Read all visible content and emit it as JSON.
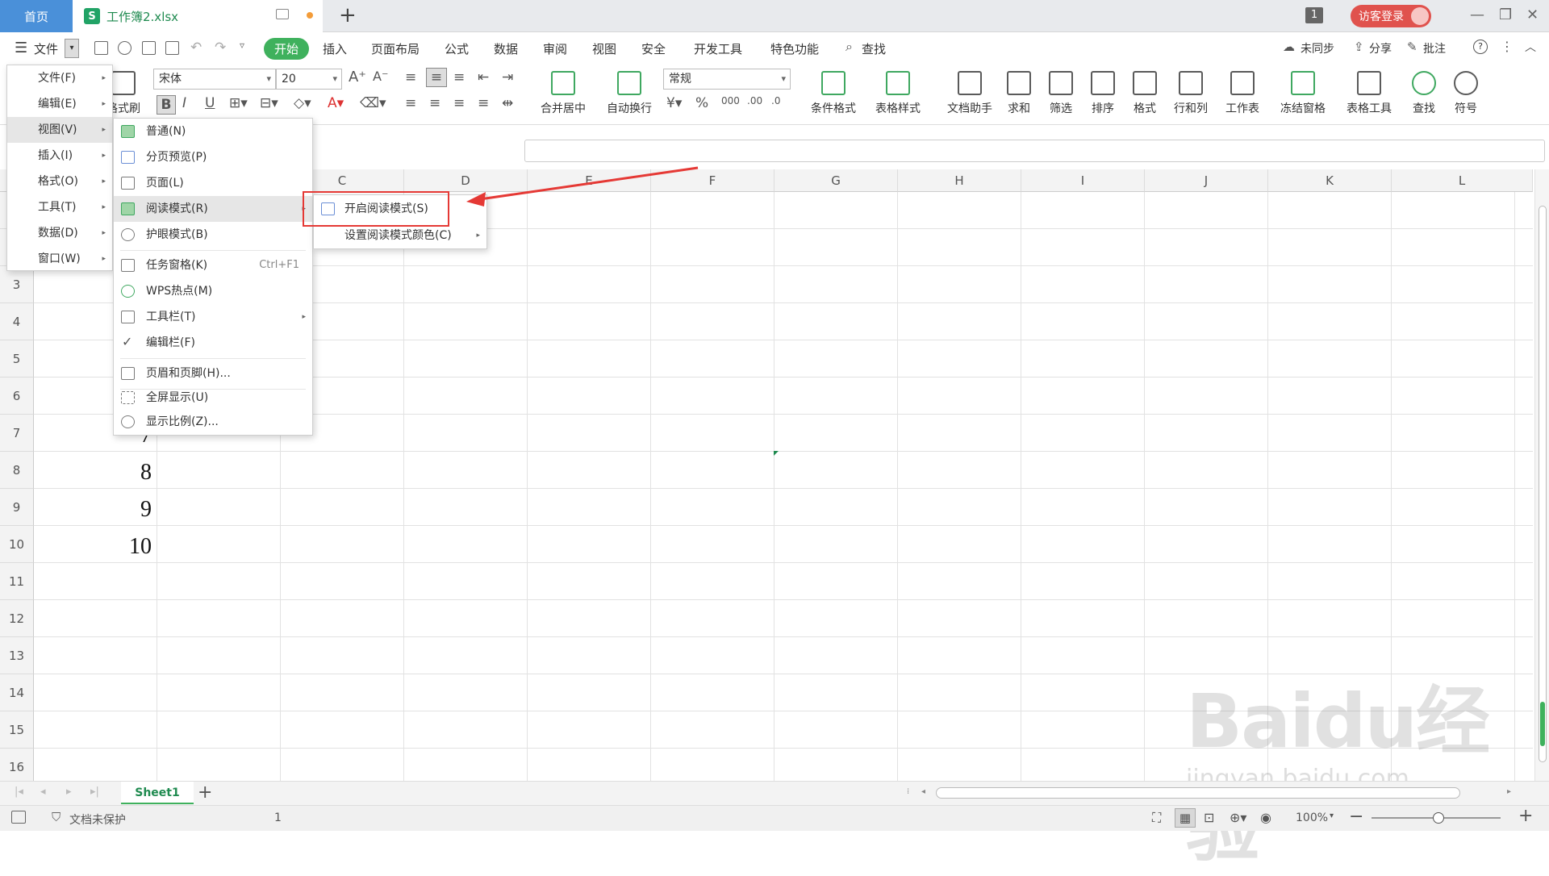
{
  "titlebar": {
    "home_tab": "首页",
    "file_tab": "工作簿2.xlsx",
    "file_icon_letter": "S",
    "window_count": "1",
    "visitor_login": "访客登录"
  },
  "menubar": {
    "file_menu": "文件",
    "tabs": [
      "开始",
      "插入",
      "页面布局",
      "公式",
      "数据",
      "审阅",
      "视图",
      "安全",
      "开发工具",
      "特色功能"
    ],
    "search": "查找",
    "right": [
      "未同步",
      "分享",
      "批注"
    ]
  },
  "ribbon": {
    "format_brush": "格式刷",
    "font_name": "宋体",
    "font_size": "20",
    "number_format": "常规",
    "merge_center": "合并居中",
    "auto_wrap": "自动换行",
    "buttons": [
      "条件格式",
      "表格样式",
      "文档助手",
      "求和",
      "筛选",
      "排序",
      "格式",
      "行和列",
      "工作表",
      "冻结窗格",
      "表格工具",
      "查找",
      "符号"
    ]
  },
  "grid": {
    "columns": [
      "C",
      "D",
      "E",
      "F",
      "G",
      "H",
      "I",
      "J",
      "K",
      "L"
    ],
    "rows": [
      "3",
      "4",
      "5",
      "6",
      "7",
      "8",
      "9",
      "10",
      "11",
      "12",
      "13",
      "14",
      "15",
      "16"
    ],
    "cells_a": [
      "7",
      "8",
      "9",
      "10"
    ]
  },
  "file_menu": {
    "items": [
      {
        "label": "文件(F)"
      },
      {
        "label": "编辑(E)"
      },
      {
        "label": "视图(V)"
      },
      {
        "label": "插入(I)"
      },
      {
        "label": "格式(O)"
      },
      {
        "label": "工具(T)"
      },
      {
        "label": "数据(D)"
      },
      {
        "label": "窗口(W)"
      }
    ]
  },
  "view_menu": {
    "items": [
      {
        "label": "普通(N)"
      },
      {
        "label": "分页预览(P)"
      },
      {
        "label": "页面(L)"
      },
      {
        "label": "阅读模式(R)"
      },
      {
        "label": "护眼模式(B)"
      },
      {
        "label": "任务窗格(K)",
        "shortcut": "Ctrl+F1"
      },
      {
        "label": "WPS热点(M)"
      },
      {
        "label": "工具栏(T)"
      },
      {
        "label": "编辑栏(F)"
      },
      {
        "label": "页眉和页脚(H)..."
      },
      {
        "label": "全屏显示(U)"
      },
      {
        "label": "显示比例(Z)..."
      }
    ]
  },
  "reading_menu": {
    "items": [
      {
        "label": "开启阅读模式(S)"
      },
      {
        "label": "设置阅读模式颜色(C)"
      }
    ]
  },
  "sheets": {
    "active": "Sheet1"
  },
  "status": {
    "protect": "文档未保护",
    "count": "1",
    "zoom": "100%"
  },
  "watermark": {
    "main": "Baidu经验",
    "sub": "jingyan.baidu.com"
  },
  "colors": {
    "accent": "#3fb15d",
    "home_tab": "#4a90d9",
    "visitor": "#e0524d",
    "highlight_box": "#e53935"
  }
}
